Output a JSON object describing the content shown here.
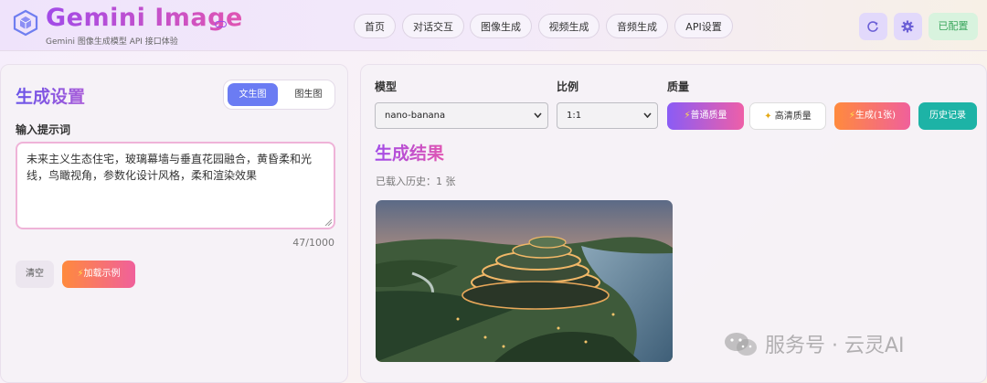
{
  "header": {
    "title": "Gemini Image",
    "subtitle": "Gemini 图像生成模型 API 接口体验",
    "nav": [
      "首页",
      "对话交互",
      "图像生成",
      "视频生成",
      "音频生成",
      "API设置"
    ],
    "status": "已配置"
  },
  "left": {
    "title": "生成设置",
    "modes": [
      "文生图",
      "图生图"
    ],
    "prompt_label": "输入提示词",
    "prompt_value": "未来主义生态住宅，玻璃幕墙与垂直花园融合，黄昏柔和光线，鸟瞰视角，参数化设计风格，柔和渲染效果",
    "counter": "47/1000",
    "clear_label": "清空",
    "example_label": "加载示例"
  },
  "right": {
    "model_label": "模型",
    "model_value": "nano-banana",
    "ratio_label": "比例",
    "ratio_value": "1:1",
    "quality_label": "质量",
    "quality_normal": "普通质量",
    "quality_hd": "高清质量",
    "generate_label": "生成(1张)",
    "history_label": "历史记录",
    "result_title": "生成结果",
    "history_status": "已载入历史：1 张"
  },
  "watermark": "服务号 · 云灵AI",
  "colors": {
    "accent_purple": "#a24be8",
    "accent_pink": "#e055b2",
    "teal": "#1db3a6",
    "orange": "#ff8a3d",
    "status_green": "#3aa65c"
  },
  "icons": [
    "cube-logo-icon",
    "toggle-icon",
    "refresh-icon",
    "gear-icon",
    "lightning-icon",
    "sparkle-icon",
    "chevron-down-icon",
    "wechat-icon"
  ]
}
